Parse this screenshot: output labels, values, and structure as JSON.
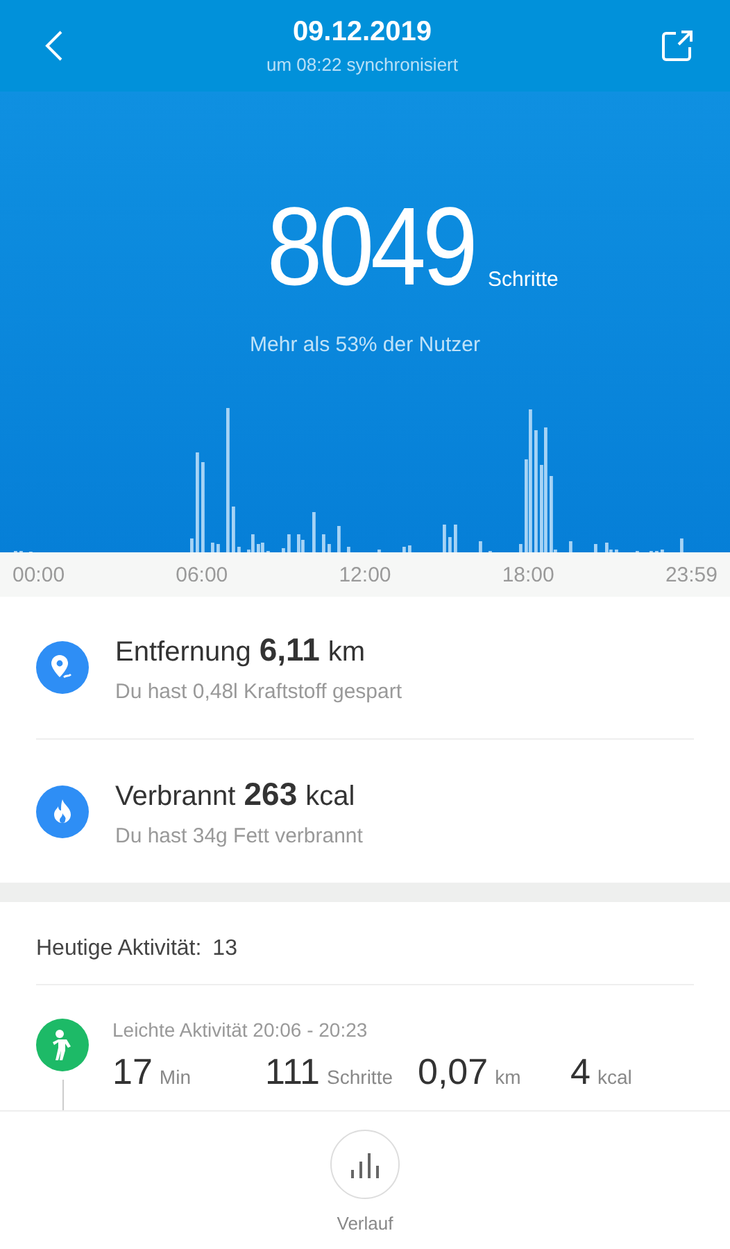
{
  "header": {
    "title": "09.12.2019",
    "subtitle": "um 08:22 synchronisiert"
  },
  "steps": {
    "value": "8049",
    "unit": "Schritte",
    "comparison": "Mehr als 53% der Nutzer"
  },
  "time_axis": [
    "00:00",
    "06:00",
    "12:00",
    "18:00",
    "23:59"
  ],
  "stats": [
    {
      "kind": "distance",
      "label": "Entfernung",
      "value": "6,11",
      "unit": "km",
      "note": "Du hast 0,48l Kraftstoff gespart"
    },
    {
      "kind": "calories",
      "label": "Verbrannt",
      "value": "263",
      "unit": "kcal",
      "note": "Du hast 34g Fett verbrannt"
    }
  ],
  "activity": {
    "label": "Heutige Aktivität:",
    "count": "13",
    "entries": [
      {
        "kind": "walk",
        "title": "Leichte Aktivität 20:06 - 20:23",
        "metrics": [
          {
            "value": "17",
            "unit": "Min"
          },
          {
            "value": "111",
            "unit": "Schritte"
          },
          {
            "value": "0,07",
            "unit": "km"
          },
          {
            "value": "4",
            "unit": "kcal"
          }
        ]
      }
    ]
  },
  "bottom_nav": {
    "label": "Verlauf"
  }
}
